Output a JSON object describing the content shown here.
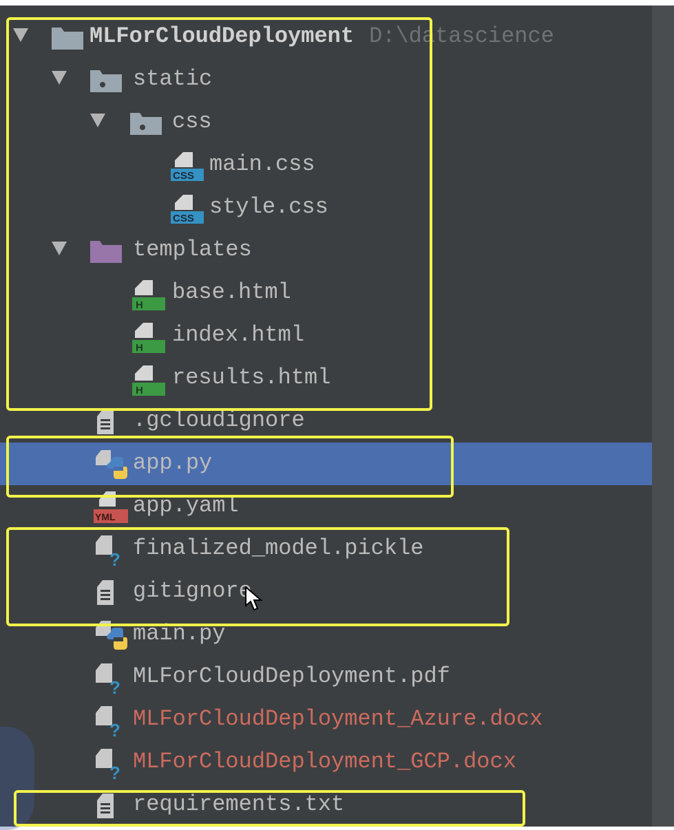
{
  "project_tree": {
    "root": {
      "name": "MLForCloudDeployment",
      "path": "D:\\datascience"
    },
    "items": [
      {
        "label": "static",
        "kind": "folder"
      },
      {
        "label": "css",
        "kind": "folder"
      },
      {
        "label": "main.css",
        "kind": "css-file"
      },
      {
        "label": "style.css",
        "kind": "css-file"
      },
      {
        "label": "templates",
        "kind": "folder-templates"
      },
      {
        "label": "base.html",
        "kind": "html-file"
      },
      {
        "label": "index.html",
        "kind": "html-file"
      },
      {
        "label": "results.html",
        "kind": "html-file"
      },
      {
        "label": ".gcloudignore",
        "kind": "text-file"
      },
      {
        "label": "app.py",
        "kind": "python-file",
        "selected": true
      },
      {
        "label": "app.yaml",
        "kind": "yaml-file"
      },
      {
        "label": "finalized_model.pickle",
        "kind": "unknown-file"
      },
      {
        "label": "gitignore",
        "kind": "text-file"
      },
      {
        "label": "main.py",
        "kind": "python-file"
      },
      {
        "label": "MLForCloudDeployment.pdf",
        "kind": "unknown-file"
      },
      {
        "label": "MLForCloudDeployment_Azure.docx",
        "kind": "unknown-file",
        "status": "unversioned"
      },
      {
        "label": "MLForCloudDeployment_GCP.docx",
        "kind": "unknown-file",
        "status": "unversioned"
      },
      {
        "label": "requirements.txt",
        "kind": "text-file"
      }
    ]
  },
  "icon_badges": {
    "css": "CSS",
    "html": "H",
    "yaml": "YML",
    "unknown": "?"
  },
  "colors": {
    "panel_bg": "#3c3f41",
    "selection": "#4b6eaf",
    "text": "#bbbbbb",
    "unversioned": "#cc6b5e",
    "highlight": "#f2f34a"
  }
}
